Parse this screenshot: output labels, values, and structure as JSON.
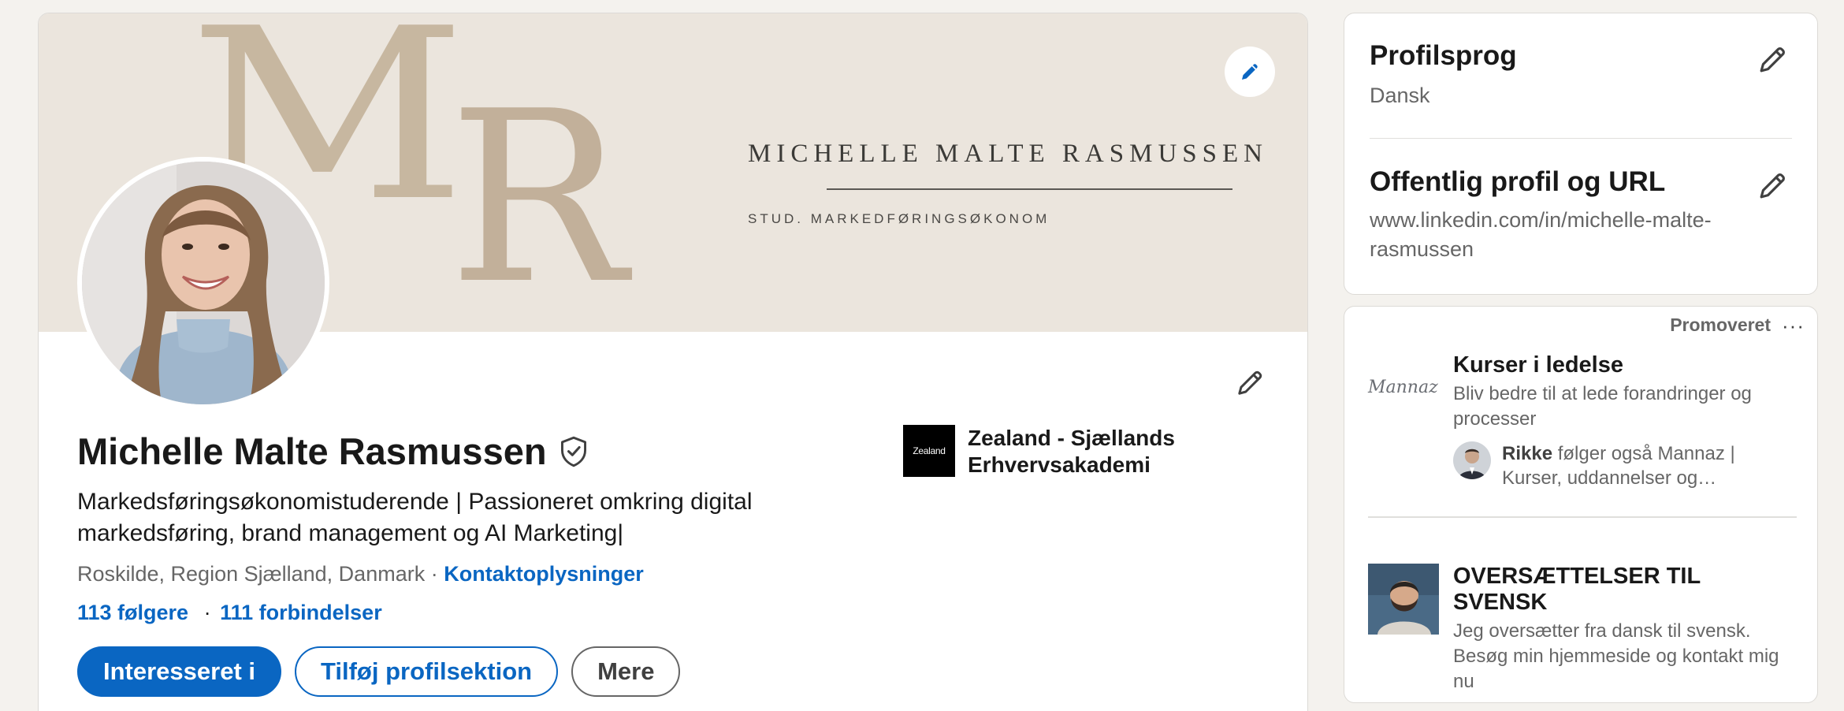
{
  "banner": {
    "monogram_left": "M",
    "monogram_right": "R",
    "name": "MICHELLE MALTE RASMUSSEN",
    "subtitle": "STUD. MARKEDFØRINGSØKONOM",
    "edit_icon": "pencil-icon"
  },
  "profile": {
    "name": "Michelle Malte Rasmussen",
    "verified_icon": "shield-check-icon",
    "headline": "Markedsføringsøkonomistuderende | Passioneret omkring digital markedsføring, brand management og AI Marketing|",
    "location": "Roskilde, Region Sjælland, Danmark",
    "location_sep": "·",
    "contact_link": "Kontaktoplysninger",
    "followers": "113 følgere",
    "stats_sep": "·",
    "connections": "111 forbindelser",
    "school": {
      "logo_text": "Zealand",
      "name": "Zealand - Sjællands Erhvervsakademi"
    },
    "actions": {
      "primary": "Interesseret i",
      "add_section": "Tilføj profilsektion",
      "more": "Mere"
    }
  },
  "sidebar": {
    "language": {
      "title": "Profilsprog",
      "value": "Dansk"
    },
    "public_profile": {
      "title": "Offentlig profil og URL",
      "url": "www.linkedin.com/in/michelle-malte-rasmussen"
    }
  },
  "promo": {
    "label": "Promoveret",
    "more": "···",
    "ads": [
      {
        "logo_text": "Mannaz",
        "title": "Kurser i ledelse",
        "text": "Bliv bedre til at lede forandringer og processer",
        "social_name": "Rikke",
        "social_text": " følger også Mannaz | Kurser, uddannelser og…"
      },
      {
        "title": "OVERSÆTTELSER TIL SVENSK",
        "text": "Jeg oversætter fra dansk til svensk. Besøg min hjemmeside og kontakt mig nu"
      }
    ]
  },
  "colors": {
    "accent": "#0a66c2",
    "banner_bg": "#ebe5dd",
    "monogram": "#c7b7a0",
    "page_bg": "#f4f2ee"
  }
}
